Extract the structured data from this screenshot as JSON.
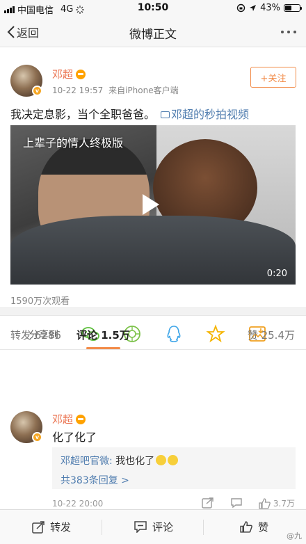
{
  "status_bar": {
    "carrier": "中国电信",
    "network": "4G",
    "time": "10:50",
    "battery": "43%",
    "battery_level": 0.43
  },
  "nav": {
    "back_label": "返回",
    "title": "微博正文"
  },
  "post": {
    "author": "邓超",
    "time": "10-22 19:57",
    "source": "来自iPhone客户端",
    "follow_label": "+关注",
    "text": "我决定息影，当个全职爸爸。",
    "video_link": "邓超的秒拍视频",
    "video_title": "上辈子的情人终极版",
    "video_duration": "0:20",
    "views": "1590万次观看"
  },
  "share": {
    "label": "分享到",
    "targets": [
      "wechat-icon",
      "moments-icon",
      "qq-icon",
      "qzone-icon",
      "save-image-icon"
    ]
  },
  "tabs": {
    "repost": "转发 6286",
    "comment": "评论 1.5万",
    "like": "赞 25.4万"
  },
  "comment": {
    "author": "邓超",
    "text": "化了化了",
    "reply_author": "邓超吧官微:",
    "reply_text": " 我也化了",
    "reply_more": "共383条回复 >",
    "time": "10-22 20:00",
    "likes": "3.7万"
  },
  "bottom_bar": {
    "repost": "转发",
    "comment": "评论",
    "like": "赞"
  },
  "watermark": "@九",
  "colors": {
    "accent": "#f28b48",
    "link": "#507daf",
    "username": "#eb7350"
  }
}
